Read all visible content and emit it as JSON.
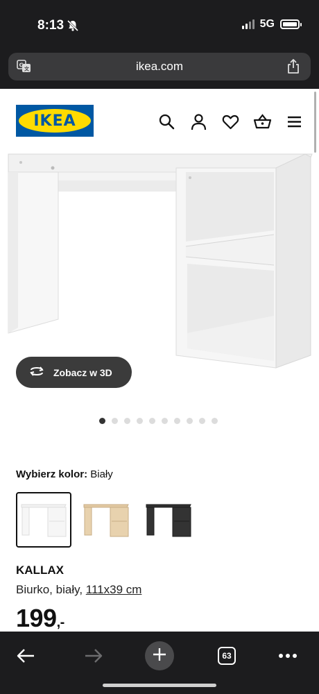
{
  "status": {
    "time": "8:13",
    "network": "5G"
  },
  "browser": {
    "url": "ikea.com",
    "tab_count": "63"
  },
  "brand": {
    "logo_text": "IKEA",
    "blue": "#0058a3",
    "yellow": "#ffdb00"
  },
  "header_icons": [
    "search-icon",
    "account-icon",
    "heart-icon",
    "basket-icon",
    "menu-icon"
  ],
  "view_3d": {
    "label": "Zobacz w 3D"
  },
  "gallery": {
    "total_images": 10,
    "active_index": 0
  },
  "color": {
    "label": "Wybierz kolor:",
    "value": "Biały",
    "options": [
      "white",
      "white-oak",
      "black-brown"
    ],
    "selected": 0
  },
  "product": {
    "name": "KALLAX",
    "desc_prefix": "Biurko, biały, ",
    "dimensions": "111x39 cm",
    "price": "199",
    "price_suffix": ",-"
  }
}
